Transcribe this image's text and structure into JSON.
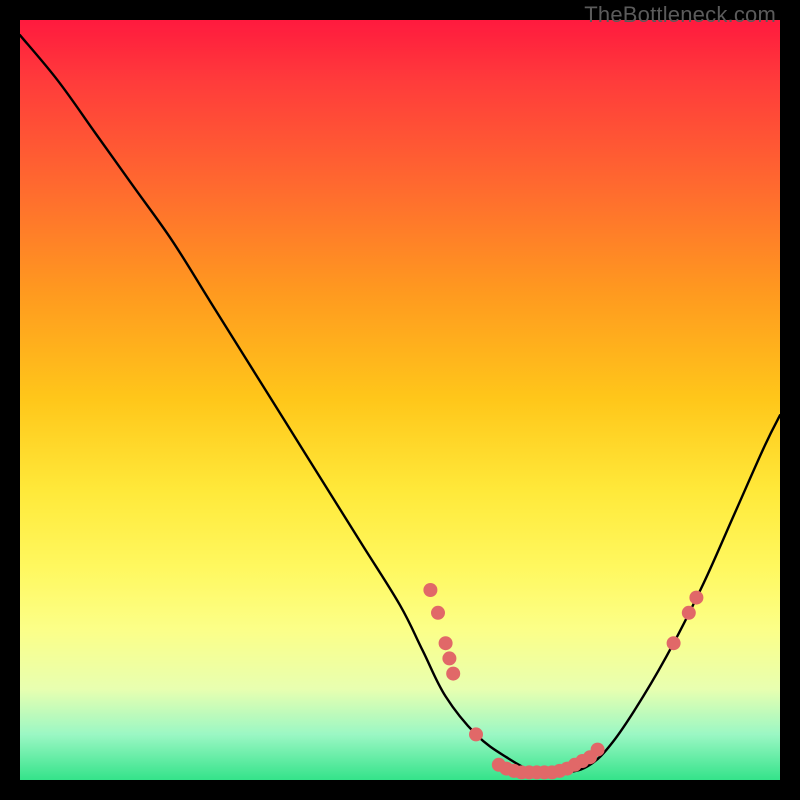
{
  "watermark": "TheBottleneck.com",
  "chart_data": {
    "type": "line",
    "title": "",
    "xlabel": "",
    "ylabel": "",
    "xlim": [
      0,
      100
    ],
    "ylim": [
      0,
      100
    ],
    "grid": false,
    "series": [
      {
        "name": "curve",
        "x": [
          0,
          5,
          10,
          15,
          20,
          25,
          30,
          35,
          40,
          45,
          50,
          53,
          56,
          60,
          64,
          68,
          72,
          75,
          78,
          82,
          86,
          90,
          94,
          98,
          100
        ],
        "y": [
          98,
          92,
          85,
          78,
          71,
          63,
          55,
          47,
          39,
          31,
          23,
          17,
          11,
          6,
          3,
          1,
          1,
          2,
          5,
          11,
          18,
          26,
          35,
          44,
          48
        ]
      }
    ],
    "markers": [
      {
        "x": 54,
        "y": 25
      },
      {
        "x": 55,
        "y": 22
      },
      {
        "x": 56,
        "y": 18
      },
      {
        "x": 56.5,
        "y": 16
      },
      {
        "x": 57,
        "y": 14
      },
      {
        "x": 60,
        "y": 6
      },
      {
        "x": 63,
        "y": 2
      },
      {
        "x": 64,
        "y": 1.5
      },
      {
        "x": 65,
        "y": 1.2
      },
      {
        "x": 66,
        "y": 1
      },
      {
        "x": 67,
        "y": 1
      },
      {
        "x": 68,
        "y": 1
      },
      {
        "x": 69,
        "y": 1
      },
      {
        "x": 70,
        "y": 1
      },
      {
        "x": 71,
        "y": 1.2
      },
      {
        "x": 72,
        "y": 1.5
      },
      {
        "x": 73,
        "y": 2
      },
      {
        "x": 74,
        "y": 2.5
      },
      {
        "x": 75,
        "y": 3
      },
      {
        "x": 76,
        "y": 4
      },
      {
        "x": 86,
        "y": 18
      },
      {
        "x": 88,
        "y": 22
      },
      {
        "x": 89,
        "y": 24
      }
    ],
    "marker_color": "#e16868",
    "curve_color": "#000000"
  }
}
